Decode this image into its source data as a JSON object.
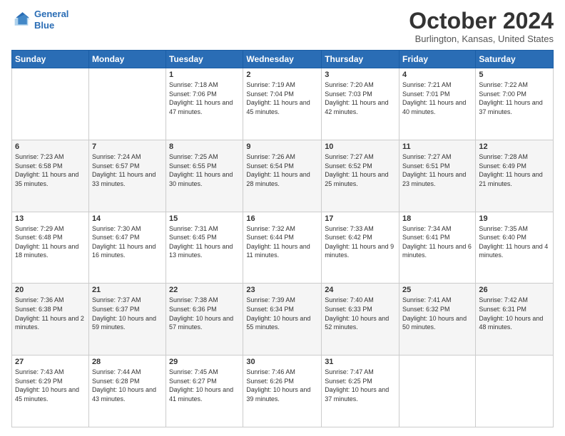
{
  "header": {
    "logo_line1": "General",
    "logo_line2": "Blue",
    "month": "October 2024",
    "location": "Burlington, Kansas, United States"
  },
  "days_of_week": [
    "Sunday",
    "Monday",
    "Tuesday",
    "Wednesday",
    "Thursday",
    "Friday",
    "Saturday"
  ],
  "weeks": [
    [
      {
        "day": "",
        "info": ""
      },
      {
        "day": "",
        "info": ""
      },
      {
        "day": "1",
        "info": "Sunrise: 7:18 AM\nSunset: 7:06 PM\nDaylight: 11 hours and 47 minutes."
      },
      {
        "day": "2",
        "info": "Sunrise: 7:19 AM\nSunset: 7:04 PM\nDaylight: 11 hours and 45 minutes."
      },
      {
        "day": "3",
        "info": "Sunrise: 7:20 AM\nSunset: 7:03 PM\nDaylight: 11 hours and 42 minutes."
      },
      {
        "day": "4",
        "info": "Sunrise: 7:21 AM\nSunset: 7:01 PM\nDaylight: 11 hours and 40 minutes."
      },
      {
        "day": "5",
        "info": "Sunrise: 7:22 AM\nSunset: 7:00 PM\nDaylight: 11 hours and 37 minutes."
      }
    ],
    [
      {
        "day": "6",
        "info": "Sunrise: 7:23 AM\nSunset: 6:58 PM\nDaylight: 11 hours and 35 minutes."
      },
      {
        "day": "7",
        "info": "Sunrise: 7:24 AM\nSunset: 6:57 PM\nDaylight: 11 hours and 33 minutes."
      },
      {
        "day": "8",
        "info": "Sunrise: 7:25 AM\nSunset: 6:55 PM\nDaylight: 11 hours and 30 minutes."
      },
      {
        "day": "9",
        "info": "Sunrise: 7:26 AM\nSunset: 6:54 PM\nDaylight: 11 hours and 28 minutes."
      },
      {
        "day": "10",
        "info": "Sunrise: 7:27 AM\nSunset: 6:52 PM\nDaylight: 11 hours and 25 minutes."
      },
      {
        "day": "11",
        "info": "Sunrise: 7:27 AM\nSunset: 6:51 PM\nDaylight: 11 hours and 23 minutes."
      },
      {
        "day": "12",
        "info": "Sunrise: 7:28 AM\nSunset: 6:49 PM\nDaylight: 11 hours and 21 minutes."
      }
    ],
    [
      {
        "day": "13",
        "info": "Sunrise: 7:29 AM\nSunset: 6:48 PM\nDaylight: 11 hours and 18 minutes."
      },
      {
        "day": "14",
        "info": "Sunrise: 7:30 AM\nSunset: 6:47 PM\nDaylight: 11 hours and 16 minutes."
      },
      {
        "day": "15",
        "info": "Sunrise: 7:31 AM\nSunset: 6:45 PM\nDaylight: 11 hours and 13 minutes."
      },
      {
        "day": "16",
        "info": "Sunrise: 7:32 AM\nSunset: 6:44 PM\nDaylight: 11 hours and 11 minutes."
      },
      {
        "day": "17",
        "info": "Sunrise: 7:33 AM\nSunset: 6:42 PM\nDaylight: 11 hours and 9 minutes."
      },
      {
        "day": "18",
        "info": "Sunrise: 7:34 AM\nSunset: 6:41 PM\nDaylight: 11 hours and 6 minutes."
      },
      {
        "day": "19",
        "info": "Sunrise: 7:35 AM\nSunset: 6:40 PM\nDaylight: 11 hours and 4 minutes."
      }
    ],
    [
      {
        "day": "20",
        "info": "Sunrise: 7:36 AM\nSunset: 6:38 PM\nDaylight: 11 hours and 2 minutes."
      },
      {
        "day": "21",
        "info": "Sunrise: 7:37 AM\nSunset: 6:37 PM\nDaylight: 10 hours and 59 minutes."
      },
      {
        "day": "22",
        "info": "Sunrise: 7:38 AM\nSunset: 6:36 PM\nDaylight: 10 hours and 57 minutes."
      },
      {
        "day": "23",
        "info": "Sunrise: 7:39 AM\nSunset: 6:34 PM\nDaylight: 10 hours and 55 minutes."
      },
      {
        "day": "24",
        "info": "Sunrise: 7:40 AM\nSunset: 6:33 PM\nDaylight: 10 hours and 52 minutes."
      },
      {
        "day": "25",
        "info": "Sunrise: 7:41 AM\nSunset: 6:32 PM\nDaylight: 10 hours and 50 minutes."
      },
      {
        "day": "26",
        "info": "Sunrise: 7:42 AM\nSunset: 6:31 PM\nDaylight: 10 hours and 48 minutes."
      }
    ],
    [
      {
        "day": "27",
        "info": "Sunrise: 7:43 AM\nSunset: 6:29 PM\nDaylight: 10 hours and 45 minutes."
      },
      {
        "day": "28",
        "info": "Sunrise: 7:44 AM\nSunset: 6:28 PM\nDaylight: 10 hours and 43 minutes."
      },
      {
        "day": "29",
        "info": "Sunrise: 7:45 AM\nSunset: 6:27 PM\nDaylight: 10 hours and 41 minutes."
      },
      {
        "day": "30",
        "info": "Sunrise: 7:46 AM\nSunset: 6:26 PM\nDaylight: 10 hours and 39 minutes."
      },
      {
        "day": "31",
        "info": "Sunrise: 7:47 AM\nSunset: 6:25 PM\nDaylight: 10 hours and 37 minutes."
      },
      {
        "day": "",
        "info": ""
      },
      {
        "day": "",
        "info": ""
      }
    ]
  ]
}
